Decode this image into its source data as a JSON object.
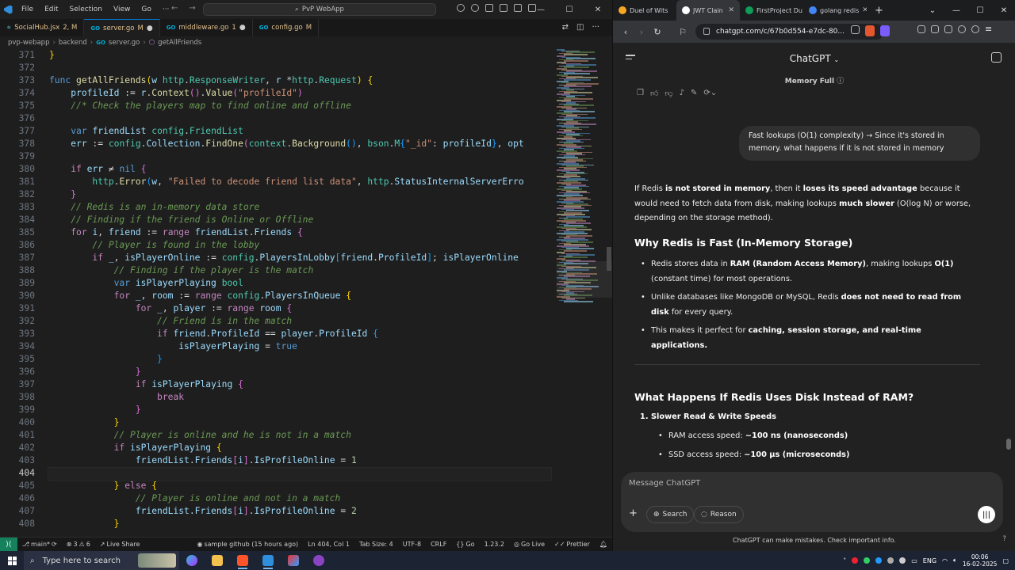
{
  "vscode": {
    "menu": [
      "File",
      "Edit",
      "Selection",
      "View",
      "Go",
      "···"
    ],
    "command_center": "PvP WebApp",
    "tabs": [
      {
        "icon": "JSX",
        "label": "SocialHub.jsx",
        "suffix": "2, M",
        "active": false
      },
      {
        "icon": "GO",
        "label": "server.go",
        "suffix": "M",
        "active": true
      },
      {
        "icon": "GO",
        "label": "middleware.go",
        "suffix": "1",
        "active": false
      },
      {
        "icon": "GO",
        "label": "config.go",
        "suffix": "M",
        "active": false
      }
    ],
    "breadcrumb": [
      "pvp-webapp",
      "backend",
      "server.go",
      "getAllFriends"
    ],
    "current_line": 404,
    "status": {
      "branch": "main*",
      "errors": "3",
      "warnings": "6",
      "live_share": "Live Share",
      "blame": "sample github (15 hours ago)",
      "position": "Ln 404, Col 1",
      "tab_size": "Tab Size: 4",
      "encoding": "UTF-8",
      "eol": "CRLF",
      "language": "Go",
      "go_version": "1.23.2",
      "go_live": "Go Live",
      "prettier": "Prettier"
    }
  },
  "code_lines": [
    {
      "n": 371,
      "html": "<span class='b1'>}</span>"
    },
    {
      "n": 372,
      "html": ""
    },
    {
      "n": 373,
      "html": "<span class='k'>func</span> <span class='f'>getAllFriends</span><span class='b1'>(</span><span class='v'>w</span> <span class='t'>http</span>.<span class='t'>ResponseWriter</span>, <span class='v'>r</span> *<span class='t'>http</span>.<span class='t'>Request</span><span class='b1'>)</span> <span class='b1'>{</span>"
    },
    {
      "n": 374,
      "html": "    <span class='v'>profileId</span> := <span class='v'>r</span>.<span class='f'>Context</span><span class='b2'>()</span>.<span class='f'>Value</span><span class='b2'>(</span><span class='s'>\"profileId\"</span><span class='b2'>)</span>"
    },
    {
      "n": 375,
      "html": "    <span class='c'>//* Check the players map to find online and offline</span>"
    },
    {
      "n": 376,
      "html": ""
    },
    {
      "n": 377,
      "html": "    <span class='k'>var</span> <span class='v'>friendList</span> <span class='t'>config</span>.<span class='t'>FriendList</span>"
    },
    {
      "n": 378,
      "html": "    <span class='v'>err</span> := <span class='t'>config</span>.<span class='v'>Collection</span>.<span class='f'>FindOne</span><span class='b2'>(</span><span class='t'>context</span>.<span class='f'>Background</span><span class='b3'>()</span>, <span class='t'>bson</span>.<span class='t'>M</span><span class='b3'>{</span><span class='s'>\"_id\"</span>: <span class='v'>profileId</span><span class='b3'>}</span>, <span class='v'>opt</span>"
    },
    {
      "n": 379,
      "html": ""
    },
    {
      "n": 380,
      "html": "    <span class='kc'>if</span> <span class='v'>err</span> ≠ <span class='k'>nil</span> <span class='b2'>{</span>"
    },
    {
      "n": 381,
      "html": "        <span class='t'>http</span>.<span class='f'>Error</span><span class='b3'>(</span><span class='v'>w</span>, <span class='s'>\"Failed to decode friend list data\"</span>, <span class='t'>http</span>.<span class='v'>StatusInternalServerErro</span>"
    },
    {
      "n": 382,
      "html": "    <span class='b2'>}</span>"
    },
    {
      "n": 383,
      "html": "    <span class='c'>// Redis is an in-memory data store</span>"
    },
    {
      "n": 384,
      "html": "    <span class='c'>// Finding if the friend is Online or Offline</span>"
    },
    {
      "n": 385,
      "html": "    <span class='kc'>for</span> <span class='v'>i</span>, <span class='v'>friend</span> := <span class='kc'>range</span> <span class='v'>friendList</span>.<span class='v'>Friends</span> <span class='b2'>{</span>"
    },
    {
      "n": 386,
      "html": "        <span class='c'>// Player is found in the lobby</span>"
    },
    {
      "n": 387,
      "html": "        <span class='kc'>if</span> <span class='v'>_</span>, <span class='v'>isPlayerOnline</span> := <span class='t'>config</span>.<span class='v'>PlayersInLobby</span><span class='b3'>[</span><span class='v'>friend</span>.<span class='v'>ProfileId</span><span class='b3'>]</span>; <span class='v'>isPlayerOnline</span>"
    },
    {
      "n": 388,
      "html": "            <span class='c'>// Finding if the player is the match</span>"
    },
    {
      "n": 389,
      "html": "            <span class='k'>var</span> <span class='v'>isPlayerPlaying</span> <span class='t'>bool</span>"
    },
    {
      "n": 390,
      "html": "            <span class='kc'>for</span> <span class='v'>_</span>, <span class='v'>room</span> := <span class='kc'>range</span> <span class='t'>config</span>.<span class='v'>PlayersInQueue</span> <span class='b1'>{</span>"
    },
    {
      "n": 391,
      "html": "                <span class='kc'>for</span> <span class='v'>_</span>, <span class='v'>player</span> := <span class='kc'>range</span> <span class='v'>room</span> <span class='b2'>{</span>"
    },
    {
      "n": 392,
      "html": "                    <span class='c'>// Friend is in the match</span>"
    },
    {
      "n": 393,
      "html": "                    <span class='kc'>if</span> <span class='v'>friend</span>.<span class='v'>ProfileId</span> == <span class='v'>player</span>.<span class='v'>ProfileId</span> <span class='b3'>{</span>"
    },
    {
      "n": 394,
      "html": "                        <span class='v'>isPlayerPlaying</span> = <span class='k'>true</span>"
    },
    {
      "n": 395,
      "html": "                    <span class='b3'>}</span>"
    },
    {
      "n": 396,
      "html": "                <span class='b2'>}</span>"
    },
    {
      "n": 397,
      "html": "                <span class='kc'>if</span> <span class='v'>isPlayerPlaying</span> <span class='b2'>{</span>"
    },
    {
      "n": 398,
      "html": "                    <span class='kc'>break</span>"
    },
    {
      "n": 399,
      "html": "                <span class='b2'>}</span>"
    },
    {
      "n": 400,
      "html": "            <span class='b1'>}</span>"
    },
    {
      "n": 401,
      "html": "            <span class='c'>// Player is online and he is not in a match</span>"
    },
    {
      "n": 402,
      "html": "            <span class='kc'>if</span> <span class='v'>isPlayerPlaying</span> <span class='b1'>{</span>"
    },
    {
      "n": 403,
      "html": "                <span class='v'>friendList</span>.<span class='v'>Friends</span><span class='b2'>[</span><span class='v'>i</span><span class='b2'>]</span>.<span class='v'>IsProfileOnline</span> = <span class='n'>1</span>"
    },
    {
      "n": 404,
      "html": ""
    },
    {
      "n": 405,
      "html": "            <span class='b1'>}</span> <span class='kc'>else</span> <span class='b1'>{</span>"
    },
    {
      "n": 406,
      "html": "                <span class='c'>// Player is online and not in a match</span>"
    },
    {
      "n": 407,
      "html": "                <span class='v'>friendList</span>.<span class='v'>Friends</span><span class='b2'>[</span><span class='v'>i</span><span class='b2'>]</span>.<span class='v'>IsProfileOnline</span> = <span class='n'>2</span>"
    },
    {
      "n": 408,
      "html": "            <span class='b1'>}</span>"
    }
  ],
  "browser": {
    "tabs": [
      {
        "label": "Duel of Wits",
        "color": "#f5a623",
        "active": false
      },
      {
        "label": "JWT Clain",
        "color": "#ffffff",
        "active": true
      },
      {
        "label": "FirstProject Du",
        "color": "#0f9d58",
        "active": false
      },
      {
        "label": "golang redis",
        "color": "#4285f4",
        "active": false
      }
    ],
    "url": "chatgpt.com/c/67b0d554-e7dc-80..."
  },
  "chatgpt": {
    "title": "ChatGPT",
    "memory": "Memory Full",
    "user_message": "Fast lookups (O(1) complexity) → Since it's stored in memory. what happens if it is not stored in memory",
    "intro": {
      "p1": "If Redis ",
      "b1": "is not stored in memory",
      "p2": ", then it ",
      "b2": "loses its speed advantage",
      "p3": " because it would need to fetch data from disk, making lookups ",
      "b3": "much slower",
      "p4": " (O(log N) or worse, depending on the storage method)."
    },
    "h_fast": "Why Redis is Fast (In-Memory Storage)",
    "bullets": [
      {
        "a": "Redis stores data in ",
        "b": "RAM (Random Access Memory)",
        "c": ", making lookups ",
        "d": "O(1)",
        "e": " (constant time) for most operations."
      },
      {
        "a": "Unlike databases like MongoDB or MySQL, Redis ",
        "b": "does not need to read from disk",
        "c": " for every query.",
        "d": "",
        "e": ""
      },
      {
        "a": "This makes it perfect for ",
        "b": "caching, session storage, and real-time applications.",
        "c": "",
        "d": "",
        "e": ""
      }
    ],
    "h_disk": "What Happens If Redis Uses Disk Instead of RAM?",
    "ol1": "1.  Slower Read & Write Speeds",
    "sub1_a": "RAM access speed: ",
    "sub1_b": "~100 ns (nanoseconds)",
    "sub2_a": "SSD access speed: ",
    "sub2_b": "~100 µs (microseconds)",
    "placeholder": "Message ChatGPT",
    "search": "Search",
    "reason": "Reason",
    "disclaimer": "ChatGPT can make mistakes. Check important info."
  },
  "taskbar": {
    "search_placeholder": "Type here to search",
    "lang": "ENG",
    "time": "00:06",
    "date": "16-02-2025"
  }
}
